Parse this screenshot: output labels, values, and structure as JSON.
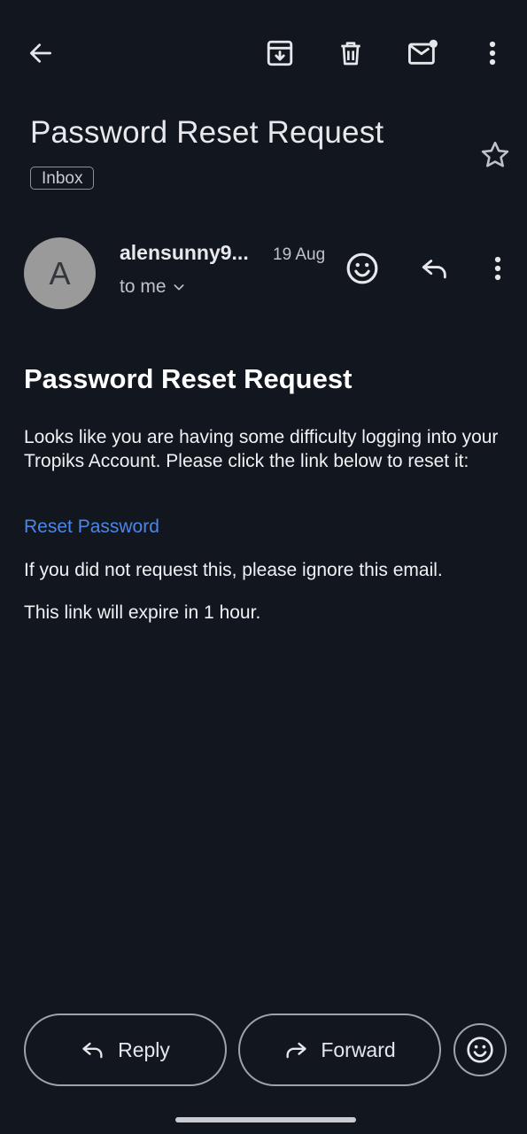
{
  "toolbar": {
    "back_icon": "arrow-left-icon",
    "archive_icon": "archive-icon",
    "delete_icon": "trash-icon",
    "mark_unread_icon": "mail-unread-icon",
    "more_icon": "more-vertical-icon"
  },
  "email": {
    "subject": "Password Reset Request",
    "label": "Inbox",
    "star_icon": "star-outline-icon",
    "sender": {
      "initial": "A",
      "name": "alensunny9...",
      "date": "19 Aug",
      "recipient": "to me"
    },
    "actions": {
      "emoji_icon": "smiley-icon",
      "reply_icon": "reply-icon",
      "more_icon": "more-vertical-icon"
    },
    "body": {
      "title": "Password Reset Request",
      "paragraph1": "Looks like you are having some difficulty logging into your Tropiks Account. Please click the link below to reset it:",
      "link_text": "Reset Password",
      "paragraph2": "If you did not request this, please ignore this email.",
      "paragraph3": "This link will expire in 1 hour."
    }
  },
  "bottom_actions": {
    "reply_label": "Reply",
    "forward_label": "Forward"
  },
  "colors": {
    "background": "#12161f",
    "link": "#4b86e6",
    "avatar": "#9a9a9a"
  }
}
